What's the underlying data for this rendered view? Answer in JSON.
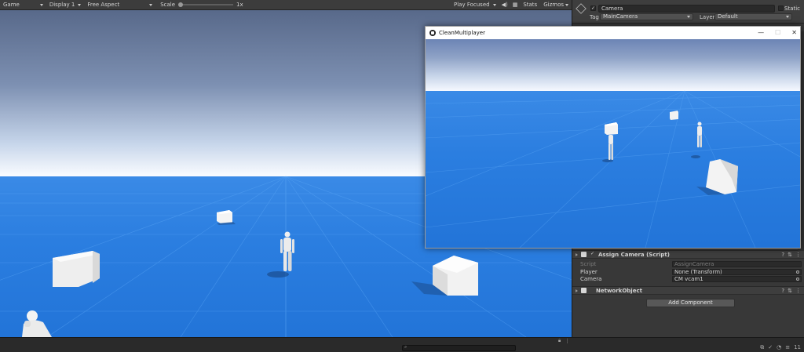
{
  "game_toolbar": {
    "view_label": "Game",
    "display": "Display 1",
    "aspect": "Free Aspect",
    "scale_label": "Scale",
    "scale_value": "1x",
    "scale_fraction": 0.0,
    "play_mode": "Play Focused",
    "stats_label": "Stats",
    "gizmos_label": "Gizmos"
  },
  "game_window": {
    "title": "CleanMultiplayer",
    "minimize": "—",
    "maximize": "☐",
    "close": "✕"
  },
  "inspector": {
    "object_name": "Camera",
    "active": true,
    "static_label": "Static",
    "tag_label": "Tag",
    "tag_value": "MainCamera",
    "layer_label": "Layer",
    "layer_value": "Default",
    "components": [
      {
        "title": "Assign Camera (Script)",
        "enabled": true,
        "properties": [
          {
            "label": "Script",
            "value": "AssignCamera",
            "disabled": true
          },
          {
            "label": "Player",
            "value": "None (Transform)"
          },
          {
            "label": "Camera",
            "value": "CM vcam1"
          }
        ]
      },
      {
        "title": "NetworkObject"
      }
    ],
    "add_component_label": "Add Component"
  },
  "statusbar": {
    "layers_count": "11"
  },
  "icons": {
    "search": "search-icon",
    "settings": "gear-icon",
    "kebab": "more-icon"
  }
}
